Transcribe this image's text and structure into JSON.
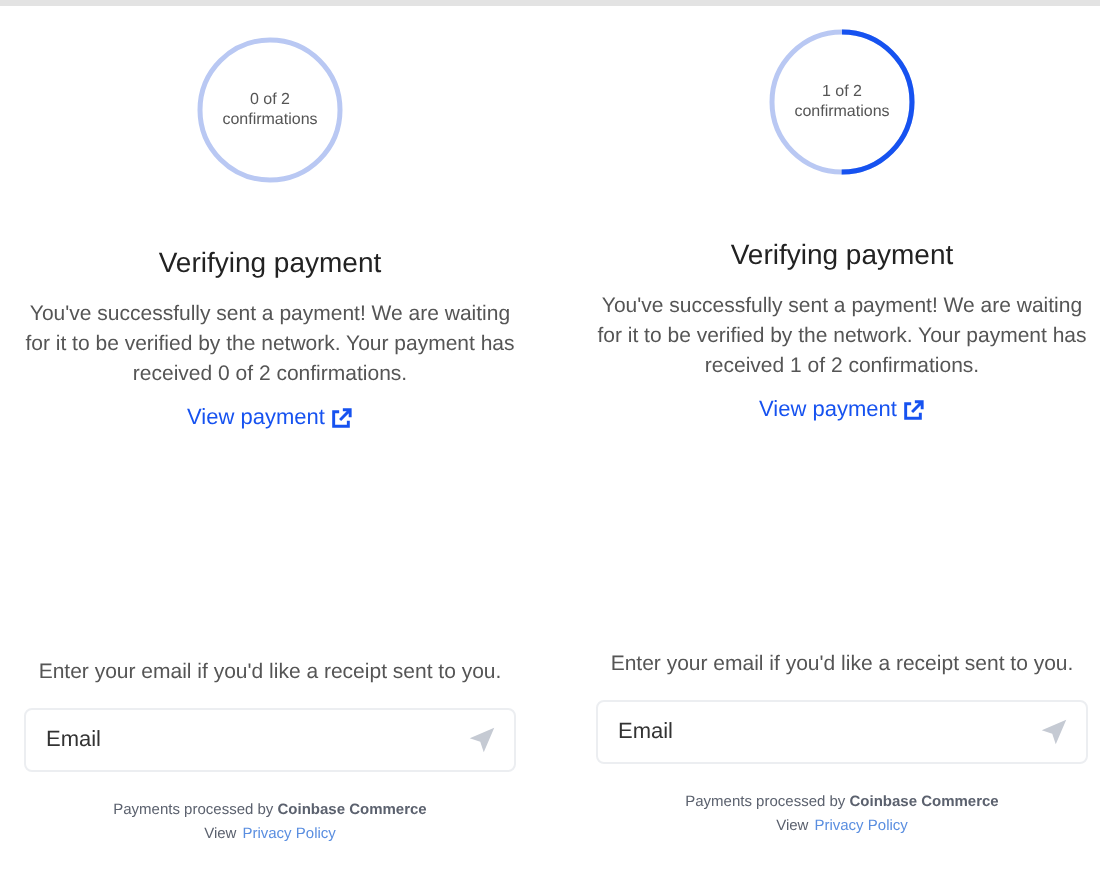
{
  "panels": [
    {
      "ring": {
        "partly_confirmed": false,
        "count": "0 of 2",
        "unit": "confirmations"
      },
      "title": "Verifying payment",
      "message": "You've successfully sent a payment! We are waiting for it to be verified by the network. Your payment has received 0 of 2 confirmations.",
      "link": "View payment",
      "prompt": "Enter your email if you'd like a receipt sent to you.",
      "email": {
        "placeholder": "Email"
      },
      "footer": "Payments processed by **Coinbase Commerce**",
      "policy_prefix": "View",
      "policy_link": "Privacy Policy"
    },
    {
      "ring": {
        "partly_confirmed": true,
        "count": "1 of 2",
        "unit": "confirmations"
      },
      "title": "Verifying payment",
      "message": "You've successfully sent a payment! We are waiting for it to be verified by the network. Your payment has received 1 of 2 confirmations.",
      "link": "View payment",
      "prompt": "Enter your email if you'd like a receipt sent to you.",
      "email": {
        "placeholder": "Email"
      },
      "footer": "Payments processed by **Coinbase Commerce**",
      "policy_prefix": "View",
      "policy_link": "Privacy Policy"
    }
  ]
}
